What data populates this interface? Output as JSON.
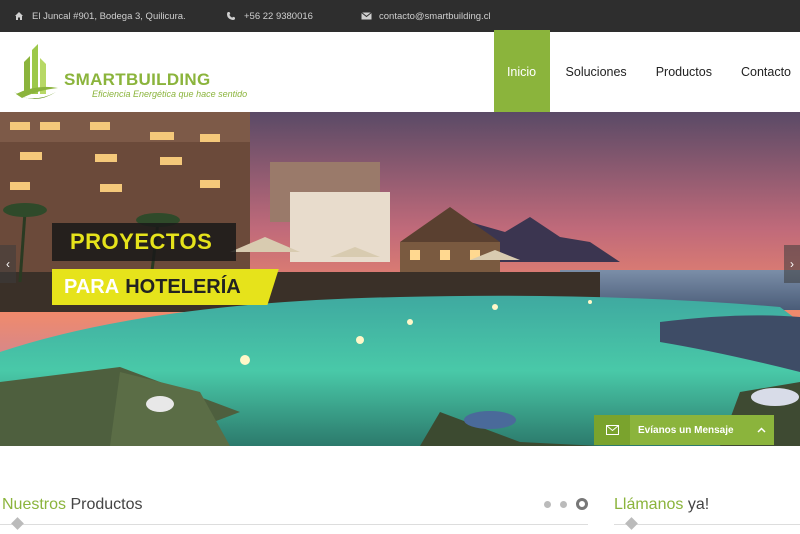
{
  "topbar": {
    "address": "El Juncal #901, Bodega 3, Quilicura.",
    "phone": "+56 22 9380016",
    "email": "contacto@smartbuilding.cl"
  },
  "logo": {
    "brand_part1": "SMART",
    "brand_part2": "BUILDING",
    "tagline": "Eficiencia Energética que hace sentido"
  },
  "nav": {
    "items": [
      "Inicio",
      "Soluciones",
      "Productos",
      "Contacto"
    ],
    "active": "Inicio"
  },
  "hero": {
    "caption_line1": "PROYECTOS",
    "caption_line2_a": "PARA",
    "caption_line2_b": "HOTELERÍA",
    "prev_arrow": "‹",
    "next_arrow": "›"
  },
  "message_button": {
    "label": "Evíanos un Mensaje"
  },
  "products": {
    "title_highlight": "Nuestros",
    "title_rest": "Productos"
  },
  "call": {
    "title_highlight": "Llámanos",
    "title_rest": "ya!"
  },
  "colors": {
    "accent": "#8bb43c",
    "yellow": "#e6e31b",
    "topbar": "#2e2e2e"
  },
  "icons": [
    "home-icon",
    "phone-icon",
    "envelope-icon",
    "chevron-up-icon"
  ]
}
